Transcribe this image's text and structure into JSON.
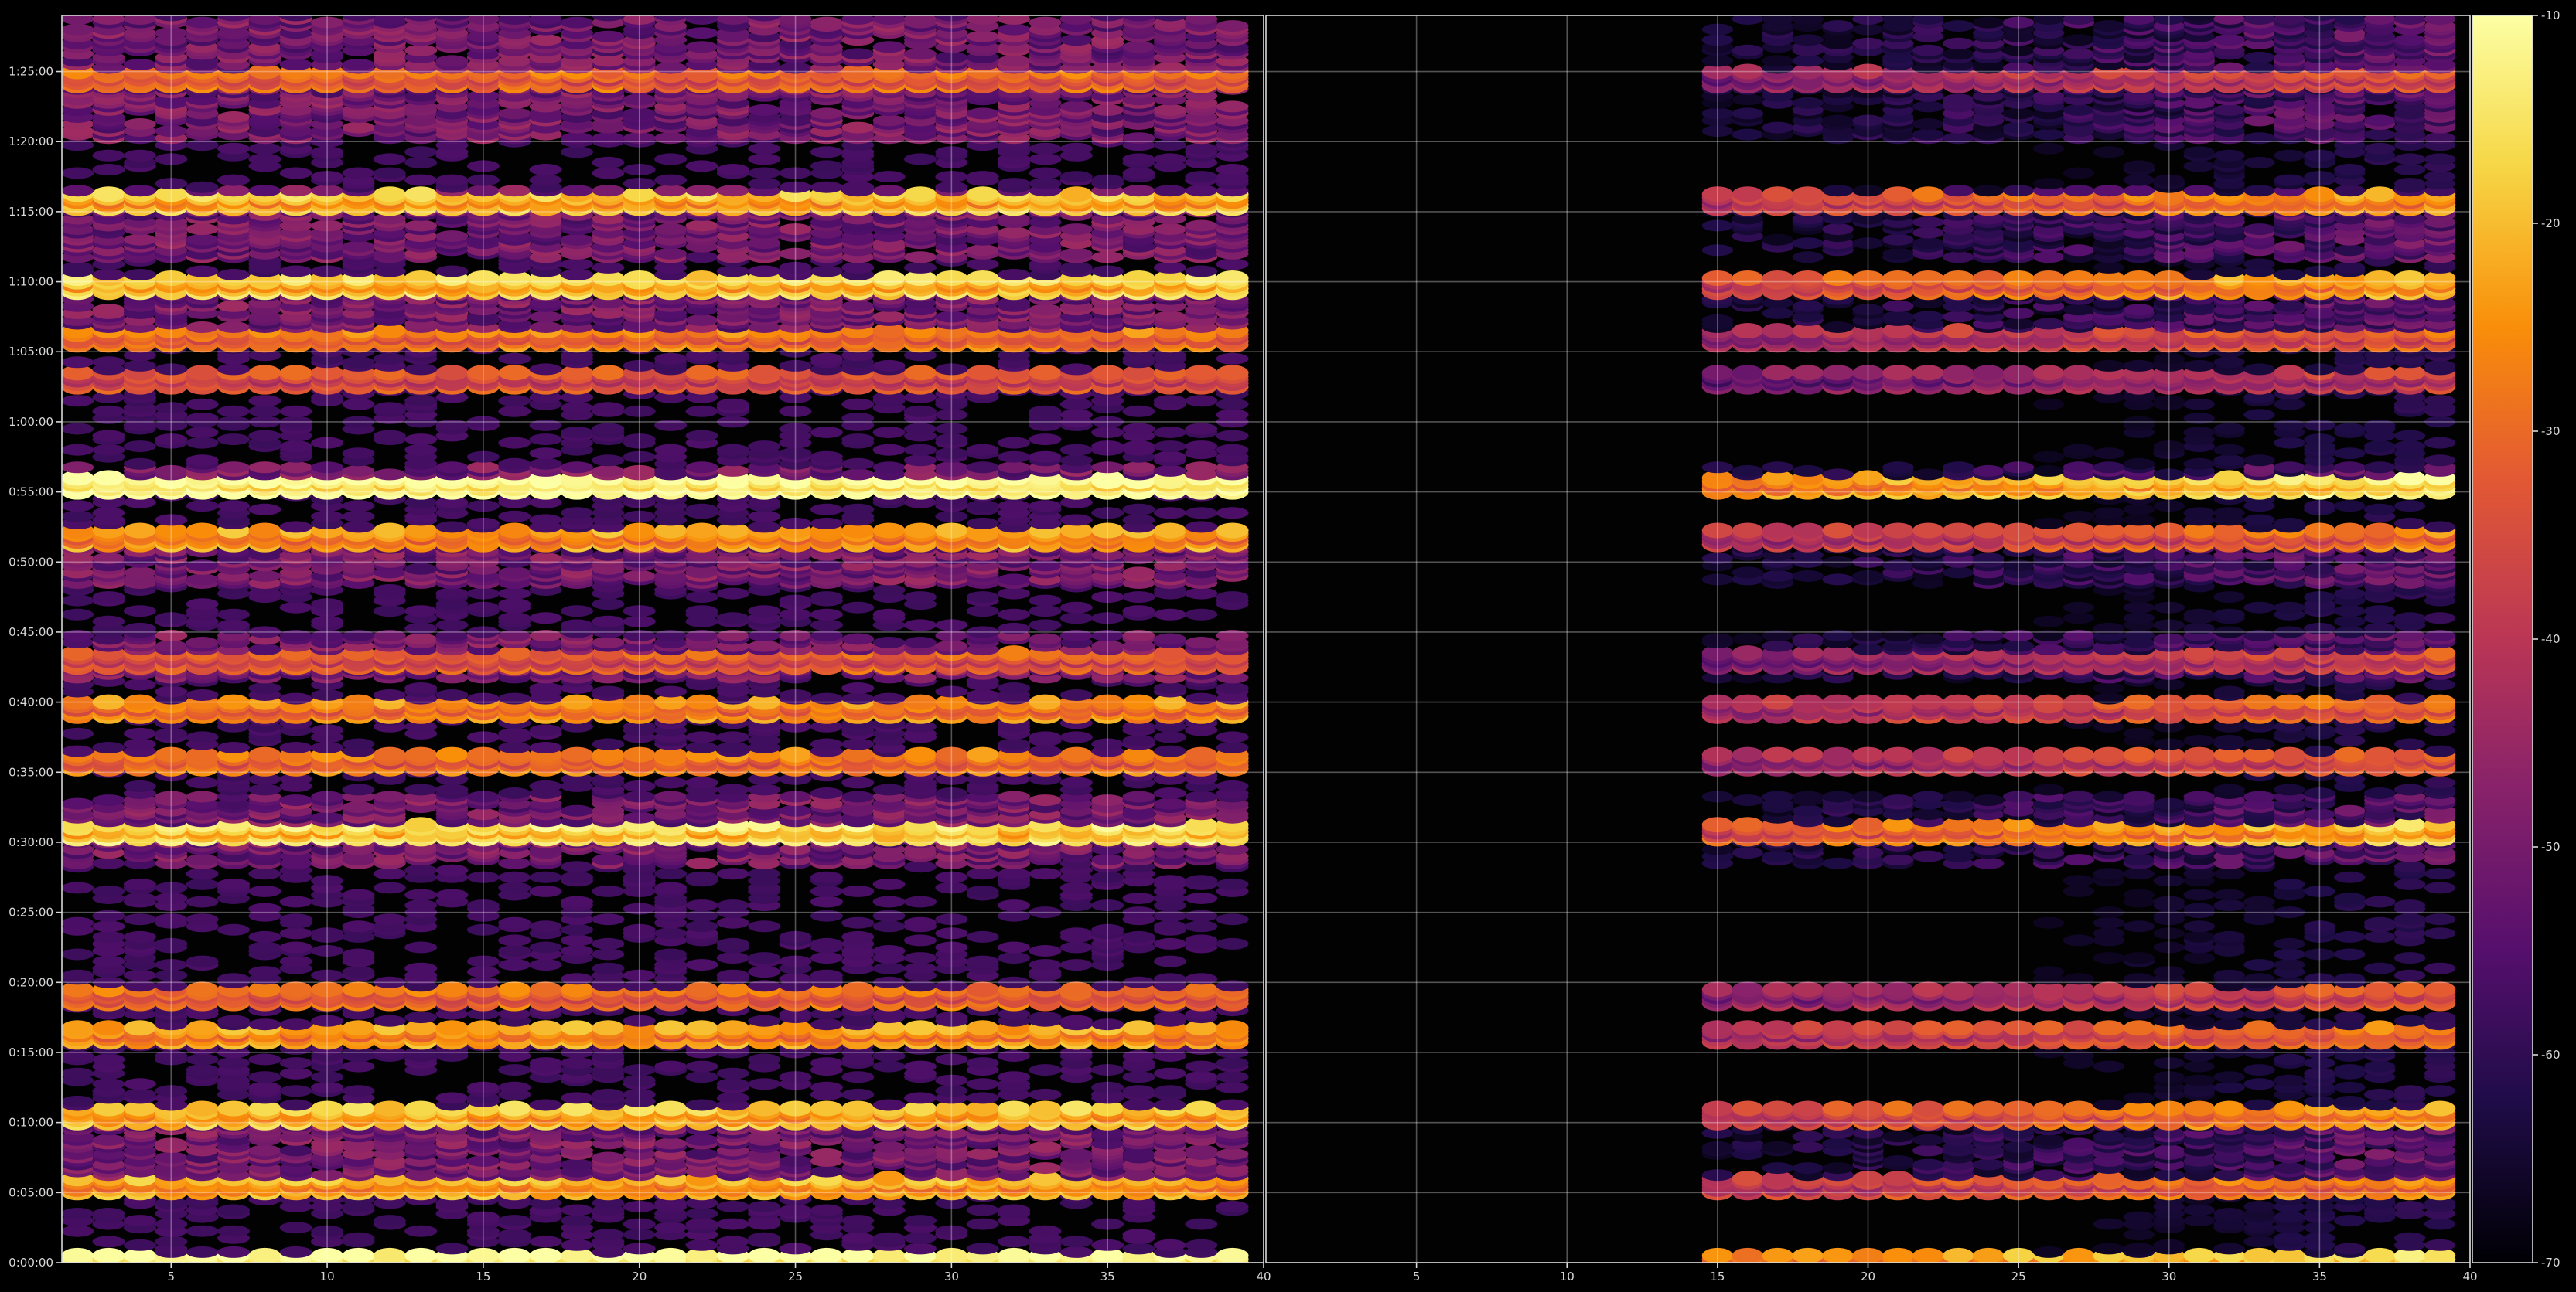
{
  "chart_data": {
    "type": "heatmap",
    "colormap": "inferno",
    "background": "#000000",
    "grid": true,
    "colorbar": {
      "position": "right",
      "range": [
        -70,
        -10
      ],
      "ticks": [
        "-10",
        "-20",
        "-30",
        "-40",
        "-50",
        "-60",
        "-70"
      ]
    },
    "panels": [
      {
        "xlim": [
          1.5,
          40
        ],
        "x_ticks": [
          "5",
          "10",
          "15",
          "20",
          "25",
          "30",
          "35",
          "40"
        ],
        "ylim": [
          0,
          5340
        ],
        "y_ticks": [
          "0:00:00",
          "0:05:00",
          "0:10:00",
          "0:15:00",
          "0:20:00",
          "0:25:00",
          "0:30:00",
          "0:35:00",
          "0:40:00",
          "0:45:00",
          "0:50:00",
          "0:55:00",
          "1:00:00",
          "1:05:00",
          "1:10:00",
          "1:15:00",
          "1:20:00",
          "1:25:00"
        ],
        "x_start": 2
      },
      {
        "xlim": [
          0,
          40
        ],
        "x_ticks": [
          "5",
          "10",
          "15",
          "20",
          "25",
          "30",
          "35",
          "40"
        ],
        "ylim": [
          0,
          5340
        ],
        "y_ticks": [],
        "x_start": 15
      }
    ],
    "strong_bands": [
      {
        "time": "0:00:00",
        "level": -18
      },
      {
        "time": "0:05:30",
        "level": -28
      },
      {
        "time": "0:10:30",
        "level": -26
      },
      {
        "time": "0:16:15",
        "level": -30
      },
      {
        "time": "0:19:00",
        "level": -36
      },
      {
        "time": "0:30:45",
        "level": -22
      },
      {
        "time": "0:35:45",
        "level": -34
      },
      {
        "time": "0:39:30",
        "level": -32
      },
      {
        "time": "0:43:00",
        "level": -38
      },
      {
        "time": "0:51:45",
        "level": -30
      },
      {
        "time": "0:55:30",
        "level": -16
      },
      {
        "time": "1:03:00",
        "level": -40
      },
      {
        "time": "1:06:00",
        "level": -34
      },
      {
        "time": "1:09:45",
        "level": -24
      },
      {
        "time": "1:15:45",
        "level": -26
      },
      {
        "time": "1:24:30",
        "level": -36
      }
    ]
  }
}
